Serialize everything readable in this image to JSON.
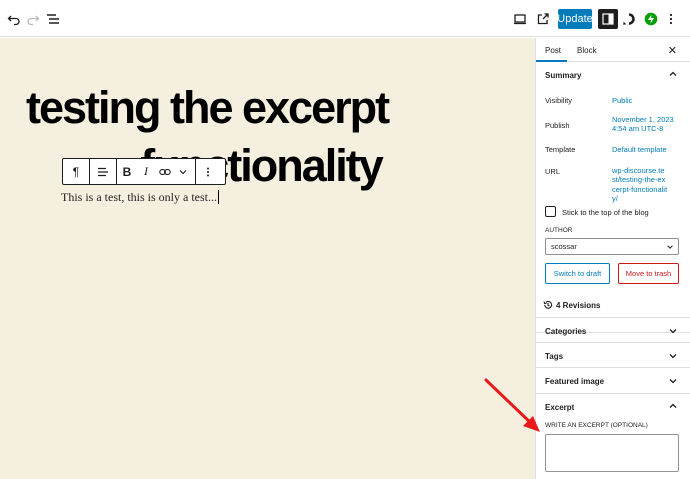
{
  "topbar": {
    "undo_icon": "undo-icon",
    "redo_icon": "redo-icon",
    "list_view_icon": "list-view-icon",
    "preview_icon": "desktop-preview-icon",
    "view_post_icon": "external-link-icon",
    "update_label": "Update",
    "settings_icon": "sidebar-settings-icon",
    "plugin_icons": [
      "discourse-icon",
      "jetpack-icon"
    ],
    "options_icon": "more-vertical-icon"
  },
  "editor": {
    "title_line1": "testing the excerpt",
    "title_line2": "functionality",
    "paragraph": "This is a test, this is only a test..."
  },
  "block_toolbar": {
    "items": [
      "paragraph-icon",
      "align-icon",
      "bold-icon",
      "italic-icon",
      "link-icon",
      "more-rich-text-icon",
      "options-icon"
    ],
    "bold_label": "B",
    "italic_label": "I",
    "paragraph_label": "¶"
  },
  "sidebar": {
    "tabs": [
      "Post",
      "Block"
    ],
    "active_tab": "Post",
    "summary": {
      "heading": "Summary",
      "rows": [
        {
          "label": "Visibility",
          "value": "Public"
        },
        {
          "label": "Publish",
          "value": "November 1, 2023 4:54 am UTC-8"
        },
        {
          "label": "Template",
          "value": "Default template"
        },
        {
          "label": "URL",
          "value": "wp-discourse.test/testing-the-excerpt-functionality/"
        }
      ],
      "sticky_label": "Stick to the top of the blog",
      "author_label": "AUTHOR",
      "author_value": "scossar",
      "switch_draft_label": "Switch to draft",
      "trash_label": "Move to trash"
    },
    "revisions_label": "4 Revisions",
    "panels": [
      "Categories",
      "Tags",
      "Featured image"
    ],
    "excerpt": {
      "heading": "Excerpt",
      "field_label": "WRITE AN EXCERPT (OPTIONAL)",
      "value": ""
    }
  },
  "colors": {
    "accent": "#007cba",
    "canvas_bg": "#f4efdf",
    "danger": "#cc1818",
    "annotation_arrow": "#e8191a",
    "jetpack_green": "#069e08"
  }
}
